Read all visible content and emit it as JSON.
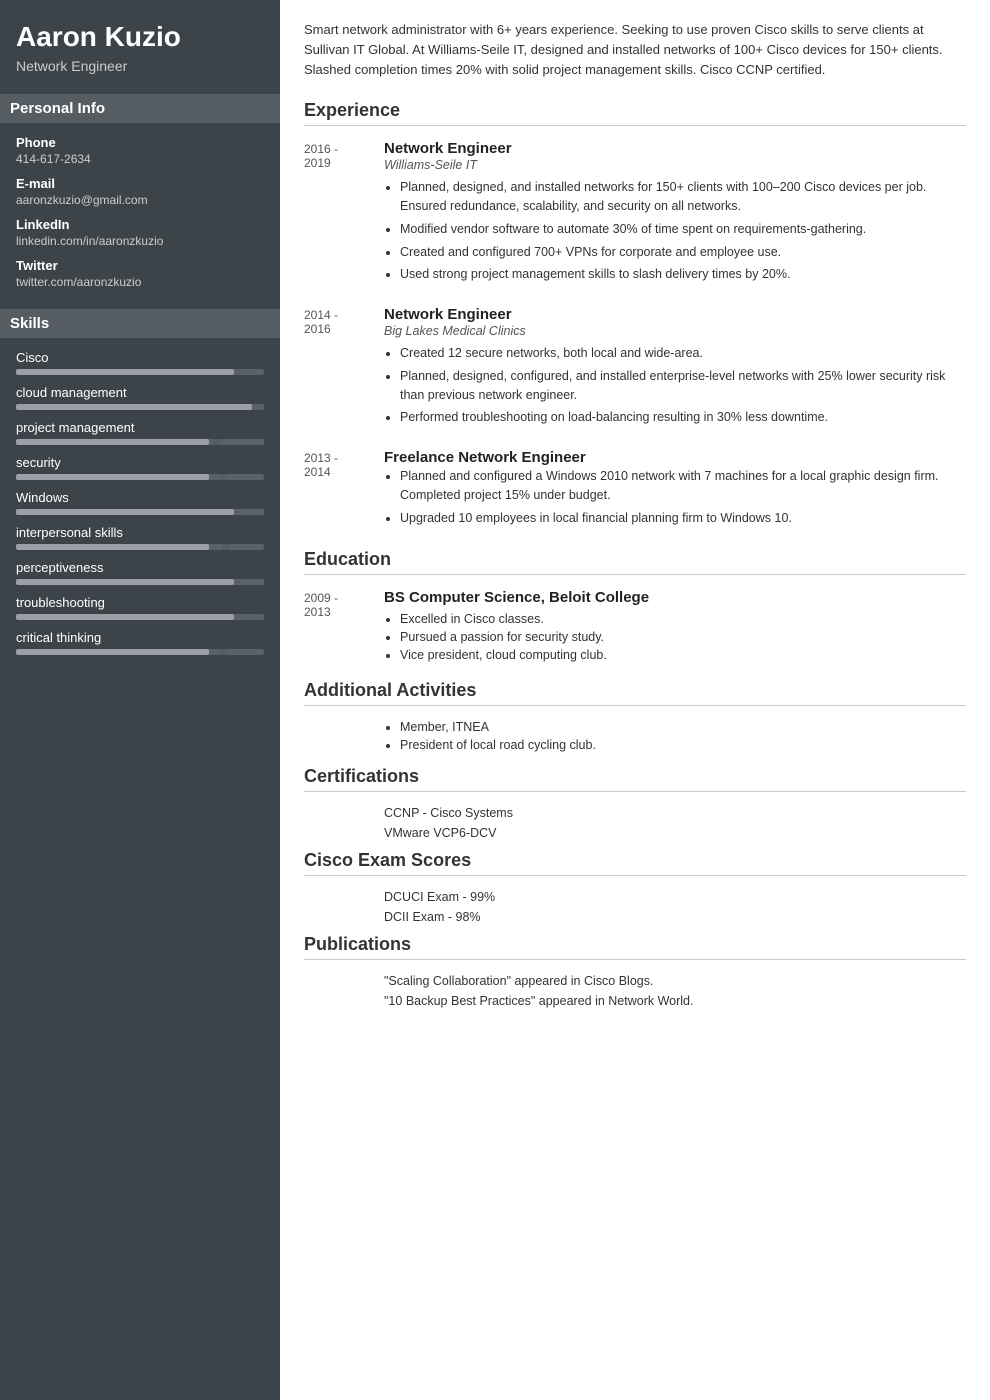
{
  "sidebar": {
    "name": "Aaron Kuzio",
    "title": "Network Engineer",
    "personal_info_label": "Personal Info",
    "phone_label": "Phone",
    "phone_value": "414-617-2634",
    "email_label": "E-mail",
    "email_value": "aaronzkuzio@gmail.com",
    "linkedin_label": "LinkedIn",
    "linkedin_value": "linkedin.com/in/aaronzkuzio",
    "twitter_label": "Twitter",
    "twitter_value": "twitter.com/aaronzkuzio",
    "skills_label": "Skills",
    "skills": [
      {
        "name": "Cisco",
        "fill": 88,
        "marker": null
      },
      {
        "name": "cloud management",
        "fill": 95,
        "marker": null
      },
      {
        "name": "project management",
        "fill": 78,
        "marker": 80
      },
      {
        "name": "security",
        "fill": 78,
        "marker": 82
      },
      {
        "name": "Windows",
        "fill": 88,
        "marker": null
      },
      {
        "name": "interpersonal skills",
        "fill": 78,
        "marker": 83
      },
      {
        "name": "perceptiveness",
        "fill": 88,
        "marker": null
      },
      {
        "name": "troubleshooting",
        "fill": 88,
        "marker": null
      },
      {
        "name": "critical thinking",
        "fill": 78,
        "marker": 82
      }
    ]
  },
  "main": {
    "summary": "Smart network administrator with 6+ years experience. Seeking to use proven Cisco skills to serve clients at Sullivan IT Global. At Williams-Seile IT, designed and installed networks of 100+ Cisco devices for 150+ clients. Slashed completion times 20% with solid project management skills. Cisco CCNP certified.",
    "experience_title": "Experience",
    "experience": [
      {
        "dates": "2016 -\n2019",
        "job_title": "Network Engineer",
        "company": "Williams-Seile IT",
        "bullets": [
          "Planned, designed, and installed networks for 150+ clients with 100–200 Cisco devices per job. Ensured redundance, scalability, and security on all networks.",
          "Modified vendor software to automate 30% of time spent on requirements-gathering.",
          "Created and configured 700+ VPNs for corporate and employee use.",
          "Used strong project management skills to slash delivery times by 20%."
        ]
      },
      {
        "dates": "2014 -\n2016",
        "job_title": "Network Engineer",
        "company": "Big Lakes Medical Clinics",
        "bullets": [
          "Created 12 secure networks, both local and wide-area.",
          "Planned, designed, configured, and installed enterprise-level networks with 25% lower security risk than previous network engineer.",
          "Performed troubleshooting on load-balancing resulting in 30% less downtime."
        ]
      },
      {
        "dates": "2013 -\n2014",
        "job_title": "Freelance Network Engineer",
        "company": "",
        "bullets": [
          "Planned and configured a Windows 2010 network with 7 machines for a local graphic design firm. Completed project 15% under budget.",
          "Upgraded 10 employees in local financial planning firm to Windows 10."
        ]
      }
    ],
    "education_title": "Education",
    "education": [
      {
        "dates": "2009 -\n2013",
        "degree": "BS Computer Science, Beloit College",
        "bullets": [
          "Excelled in Cisco classes.",
          "Pursued a passion for security study.",
          "Vice president, cloud computing club."
        ]
      }
    ],
    "activities_title": "Additional Activities",
    "activities": [
      "Member, ITNEA",
      "President of local road cycling club."
    ],
    "certifications_title": "Certifications",
    "certifications": [
      "CCNP - Cisco Systems",
      "VMware VCP6-DCV"
    ],
    "exam_scores_title": "Cisco Exam Scores",
    "exam_scores": [
      "DCUCI Exam - 99%",
      "DCII Exam - 98%"
    ],
    "publications_title": "Publications",
    "publications": [
      "\"Scaling Collaboration\" appeared in Cisco Blogs.",
      "\"10 Backup Best Practices\" appeared in Network World."
    ]
  }
}
